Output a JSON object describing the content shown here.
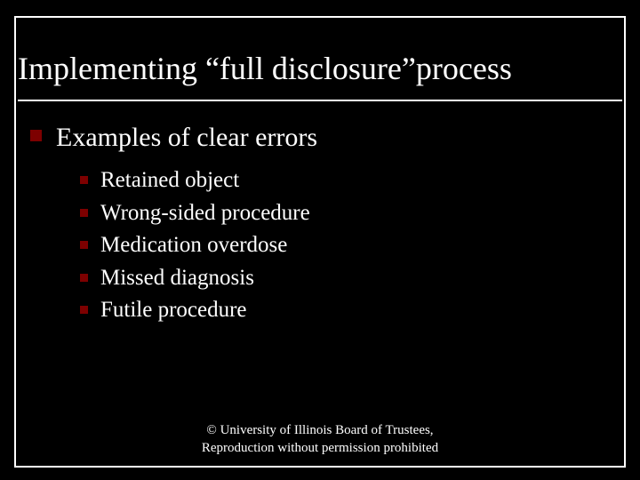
{
  "title": "Implementing “full disclosure”process",
  "lvl1": {
    "text": "Examples of clear errors"
  },
  "lvl2": [
    {
      "text": "Retained object"
    },
    {
      "text": "Wrong-sided procedure"
    },
    {
      "text": "Medication overdose"
    },
    {
      "text": "Missed diagnosis"
    },
    {
      "text": "Futile procedure"
    }
  ],
  "footer": {
    "line1": "© University of Illinois Board of Trustees,",
    "line2": "Reproduction without permission prohibited"
  }
}
